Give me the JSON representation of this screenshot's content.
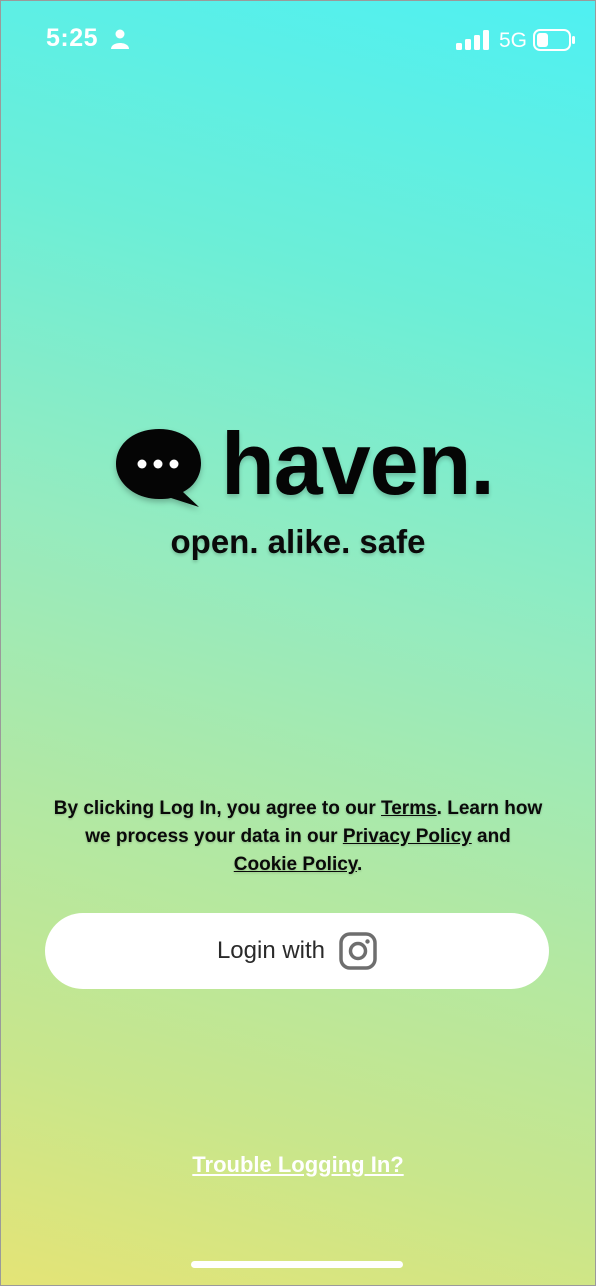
{
  "status_bar": {
    "time": "5:25",
    "network": "5G",
    "icons": [
      "person-icon",
      "signal-icon",
      "battery-icon"
    ]
  },
  "brand": {
    "name": "haven.",
    "tagline": "open. alike. safe",
    "logo_icon": "chat-bubble-icon"
  },
  "legal": {
    "prefix": "By clicking Log In, you agree to our ",
    "terms": "Terms",
    "middle": ". Learn how we process your data in our ",
    "privacy": "Privacy Policy",
    "and": " and ",
    "cookie": "Cookie Policy",
    "suffix": "."
  },
  "login": {
    "label": "Login with",
    "icon": "instagram-icon"
  },
  "trouble_link": "Trouble Logging In?",
  "colors": {
    "gradient_top": "#4ff0f2",
    "gradient_bottom": "#e4e476",
    "button_bg": "#ffffff",
    "text_dark": "#0a0a0a"
  }
}
